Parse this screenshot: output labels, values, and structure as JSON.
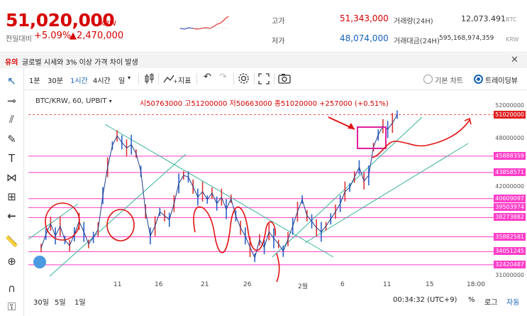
{
  "ticker": {
    "price": "51,020,000",
    "unit": "KRW",
    "change_label": "전일대비",
    "change_pct": "+5.09%",
    "change_amt": "▲2,470,000"
  },
  "stats": {
    "high_label": "고가",
    "high": "51,343,000",
    "low_label": "저가",
    "low": "48,074,000",
    "vol_label": "거래량(24H)",
    "vol": "12,073.491",
    "vol_unit": "BTC",
    "amt_label": "거래대금(24H)",
    "amt": "595,168,974,359",
    "amt_unit": "KRW"
  },
  "notice": {
    "tag": "유의",
    "message": "글로벌 시세와 3% 이상 가격 차이 발생",
    "close": "✕"
  },
  "toolbar": {
    "intervals": [
      "1분",
      "30분",
      "1시간",
      "4시간",
      "일"
    ],
    "active_interval": "1시간",
    "candle_icon": "candles-icon",
    "indicator": "지표",
    "undo": "↶",
    "redo": "↷",
    "basic_chart": "기본 차트",
    "tradingview": "트레이딩뷰"
  },
  "chart_data": {
    "type": "line",
    "symbol_legend": "BTC/KRW, 60, UPBIT",
    "ohlc": "시50763000  고51200000  저50663000  종51020000  +257000 (+0.51%)",
    "x_ticks": [
      "11",
      "16",
      "21",
      "26",
      "2월",
      "6",
      "11",
      "15",
      "18:00"
    ],
    "y_ticks": [
      "52000000",
      "48000000",
      "42000000",
      "38000000",
      "31000000"
    ],
    "price_tags": [
      "45888359",
      "43858571",
      "40609097",
      "39503974",
      "38273882",
      "35882581",
      "34051245",
      "32420487"
    ],
    "last_price": "51020000",
    "series": [
      {
        "values": [
          34500000,
          36200000,
          37500000,
          36000000,
          37200000,
          35500000,
          34800000,
          36200000,
          37800000,
          36500000,
          35000000,
          35800000,
          36800000,
          41000000,
          44500000,
          47200000,
          48400000,
          47600000,
          46900000,
          47300000,
          46200000,
          44000000,
          39000000,
          36000000,
          37200000,
          39000000,
          38500000,
          38000000,
          40000000,
          42500000,
          43500000,
          43300000,
          42100000,
          40800000,
          41500000,
          40500000,
          41300000,
          40000000,
          40800000,
          39300000,
          40600000,
          38500000,
          37000000,
          36000000,
          34600000,
          33300000,
          35500000,
          34600000,
          36500000,
          35700000,
          35000000,
          34100000,
          35600000,
          37200000,
          39000000,
          40500000,
          38500000,
          37800000,
          37000000,
          36500000,
          37200000,
          38100000,
          39000000,
          40000000,
          41500000,
          42000000,
          43300000,
          44500000,
          42800000,
          43500000,
          47000000,
          48500000,
          49600000,
          49200000,
          50000000,
          51020000
        ],
        "ylim": [
          31000000,
          53000000
        ]
      }
    ],
    "xlabel": "",
    "ylabel": ""
  },
  "timeframes": [
    "30일",
    "5일",
    "1일"
  ],
  "status": {
    "clock": "00:34:32 (UTC+9)",
    "percent": "%",
    "log": "로그",
    "auto": "자동"
  }
}
